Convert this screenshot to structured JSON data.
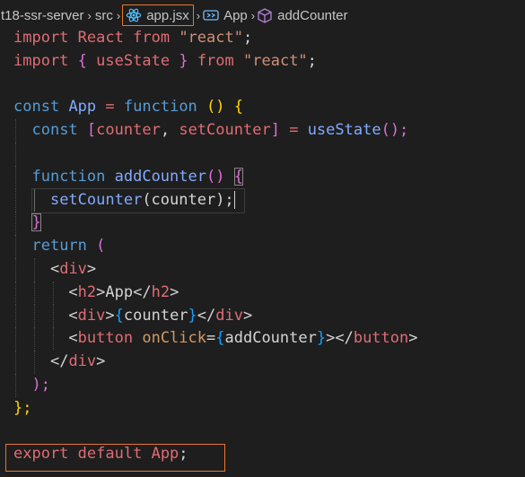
{
  "breadcrumb": {
    "folder": "t18-ssr-server",
    "subfolder": "src",
    "file": "app.jsx",
    "symbol1": "App",
    "symbol2": "addCounter"
  },
  "code": {
    "l1": [
      "import",
      "React",
      "from",
      "\"react\"",
      ";"
    ],
    "l2": [
      "import",
      "{",
      "useState",
      "}",
      "from",
      "\"react\"",
      ";"
    ],
    "l4": [
      "const",
      "App",
      "=",
      "function",
      "()",
      "{"
    ],
    "l5": [
      "const",
      "[",
      "counter",
      ",",
      "setCounter",
      "]",
      "=",
      "useState",
      "();"
    ],
    "l7": [
      "function",
      "addCounter",
      "()",
      "{"
    ],
    "l8": [
      "setCounter",
      "(counter);"
    ],
    "l9": [
      "}"
    ],
    "l10": [
      "return",
      "("
    ],
    "l11": [
      "<",
      "div",
      ">"
    ],
    "l12": [
      "<",
      "h2",
      ">",
      "App",
      "</",
      "h2",
      ">"
    ],
    "l13": [
      "<",
      "div",
      ">",
      "{",
      "counter",
      "}",
      "</",
      "div",
      ">"
    ],
    "l14": [
      "<",
      "button",
      "onClick",
      "=",
      "{",
      "addCounter",
      "}",
      "></",
      "button",
      ">"
    ],
    "l15": [
      "</",
      "div",
      ">"
    ],
    "l16": [
      ");"
    ],
    "l17": [
      "};"
    ],
    "l19": [
      "export",
      "default",
      "App",
      ";"
    ]
  },
  "colors": {
    "highlight": "#e8762e",
    "background": "#1e1e1e"
  },
  "icons": {
    "react": "react-atom-icon",
    "symbol": "symbol-variable-icon",
    "method": "method-cube-icon"
  }
}
